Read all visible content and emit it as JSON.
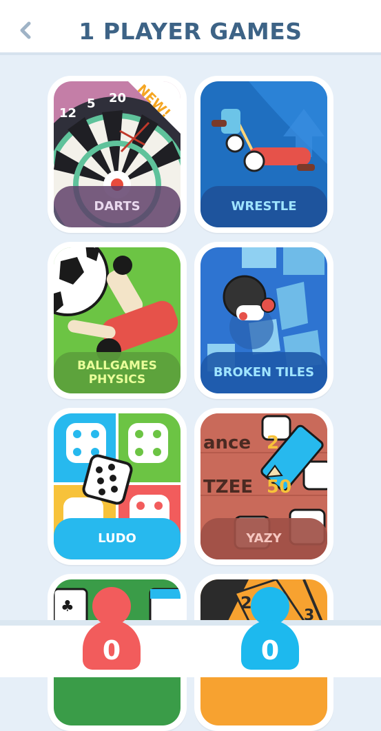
{
  "header": {
    "title": "1 PLAYER GAMES",
    "back_icon": "chevron-left-icon"
  },
  "colors": {
    "background": "#e6eff8",
    "title": "#3d6386",
    "player1": "#f25c5c",
    "player2": "#1db9ee"
  },
  "games": [
    {
      "label": "DARTS",
      "badge": "NEW!",
      "dart_numbers": [
        "12",
        "5",
        "20"
      ]
    },
    {
      "label": "WRESTLE"
    },
    {
      "label": "BALLGAMES\nPHYSICS"
    },
    {
      "label": "BROKEN TILES"
    },
    {
      "label": "LUDO"
    },
    {
      "label": "YAZY",
      "sheet_text_1": "ance",
      "sheet_text_2": "TZEE",
      "sheet_score": "50",
      "sheet_score_2": "2"
    }
  ],
  "partial_games": [
    {
      "icon": "cards-icon"
    },
    {
      "numbers": [
        "2",
        "3"
      ]
    }
  ],
  "players": [
    {
      "score": "0"
    },
    {
      "score": "0"
    }
  ]
}
